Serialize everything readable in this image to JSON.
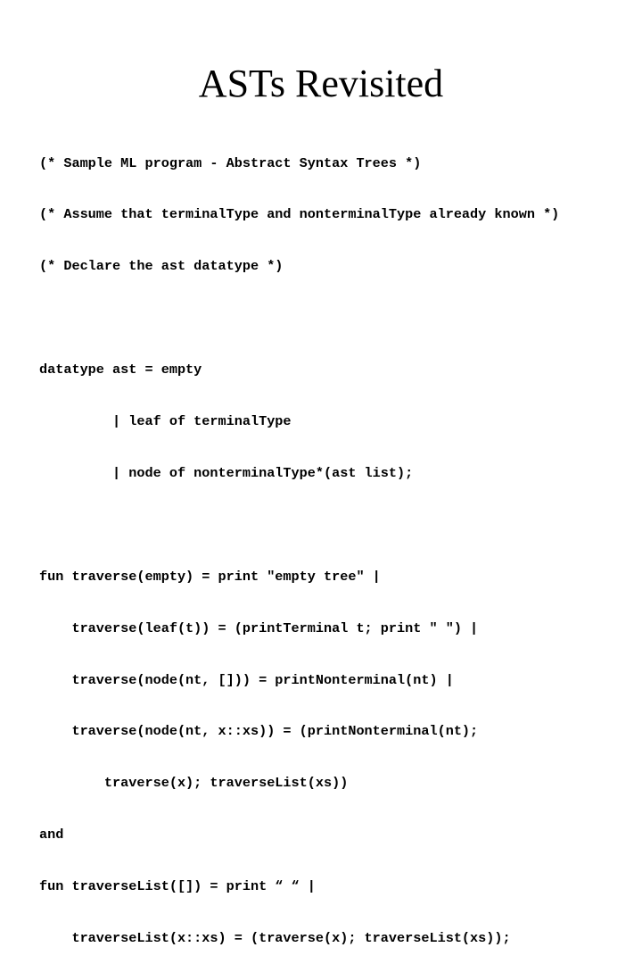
{
  "slide": {
    "title": "ASTs Revisited",
    "code_lines": [
      "(* Sample ML program - Abstract Syntax Trees *)",
      "(* Assume that terminalType and nonterminalType already known *)",
      "(* Declare the ast datatype *)",
      "",
      "datatype ast = empty",
      "         | leaf of terminalType",
      "         | node of nonterminalType*(ast list);",
      "",
      "fun traverse(empty) = print \"empty tree\" |",
      "    traverse(leaf(t)) = (printTerminal t; print \" \") |",
      "    traverse(node(nt, [])) = printNonterminal(nt) |",
      "    traverse(node(nt, x::xs)) = (printNonterminal(nt);",
      "        traverse(x); traverseList(xs))",
      "and",
      "fun traverseList([]) = print “ “ |",
      "    traverseList(x::xs) = (traverse(x); traverseList(xs));"
    ]
  }
}
